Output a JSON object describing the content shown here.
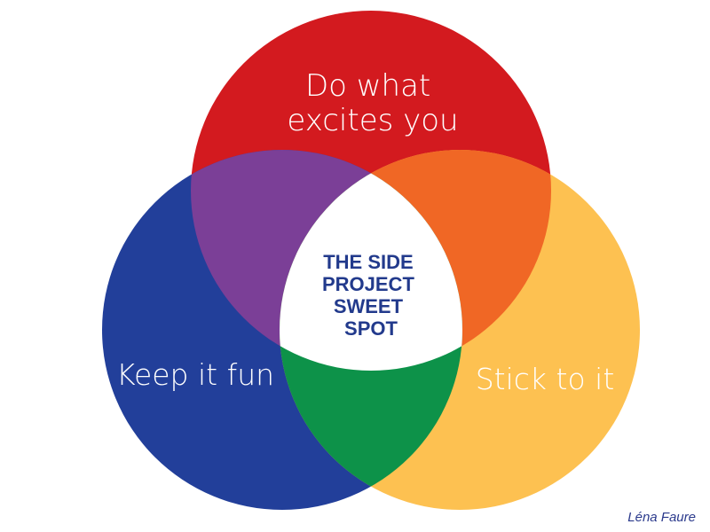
{
  "diagram": {
    "type": "venn",
    "circles": [
      {
        "id": "top",
        "label_lines": [
          "Do what",
          "excites you"
        ],
        "color": "#D31A1F"
      },
      {
        "id": "left",
        "label_lines": [
          "Keep it fun"
        ],
        "color": "#223F9A"
      },
      {
        "id": "right",
        "label_lines": [
          "Stick to it"
        ],
        "color": "#FDC151"
      }
    ],
    "overlaps": {
      "top_left": "#7B3F97",
      "top_right": "#F06725",
      "left_right": "#0D9249",
      "center": "#FFFFFF"
    },
    "center_label_lines": [
      "THE SIDE",
      "PROJECT",
      "SWEET",
      "SPOT"
    ],
    "center_label_color": "#223A8C",
    "credit": "Léna Faure",
    "credit_color": "#2B3A8C"
  }
}
